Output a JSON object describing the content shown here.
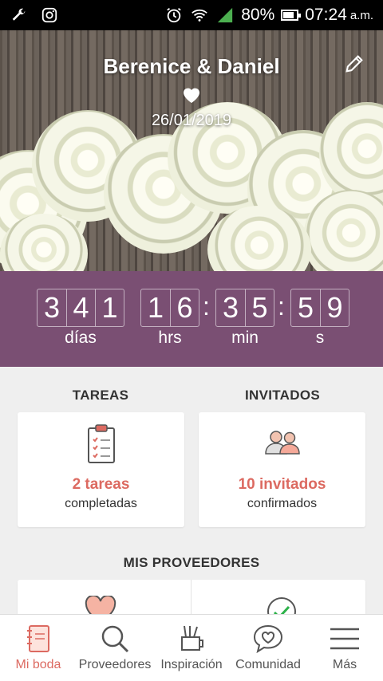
{
  "status_bar": {
    "battery": "80%",
    "time": "07:24",
    "ampm": "a.m."
  },
  "hero": {
    "names": "Berenice & Daniel",
    "date": "26/01/2019"
  },
  "countdown": {
    "days": [
      "3",
      "4",
      "1"
    ],
    "hours": [
      "1",
      "6"
    ],
    "minutes": [
      "3",
      "5"
    ],
    "seconds": [
      "5",
      "9"
    ],
    "labels": {
      "days": "días",
      "hours": "hrs",
      "minutes": "min",
      "seconds": "s"
    }
  },
  "tasks": {
    "title": "TAREAS",
    "count": "2 tareas",
    "caption": "completadas"
  },
  "guests": {
    "title": "INVITADOS",
    "count": "10 invitados",
    "caption": "confirmados"
  },
  "vendors": {
    "title": "MIS PROVEEDORES"
  },
  "nav": [
    {
      "label": "Mi boda",
      "icon": "notebook-icon"
    },
    {
      "label": "Proveedores",
      "icon": "search-icon"
    },
    {
      "label": "Inspiración",
      "icon": "brush-cup-icon"
    },
    {
      "label": "Comunidad",
      "icon": "chat-heart-icon"
    },
    {
      "label": "Más",
      "icon": "menu-icon"
    }
  ],
  "colors": {
    "accent": "#dc6a61",
    "countdown_bg": "#7a4f73"
  }
}
